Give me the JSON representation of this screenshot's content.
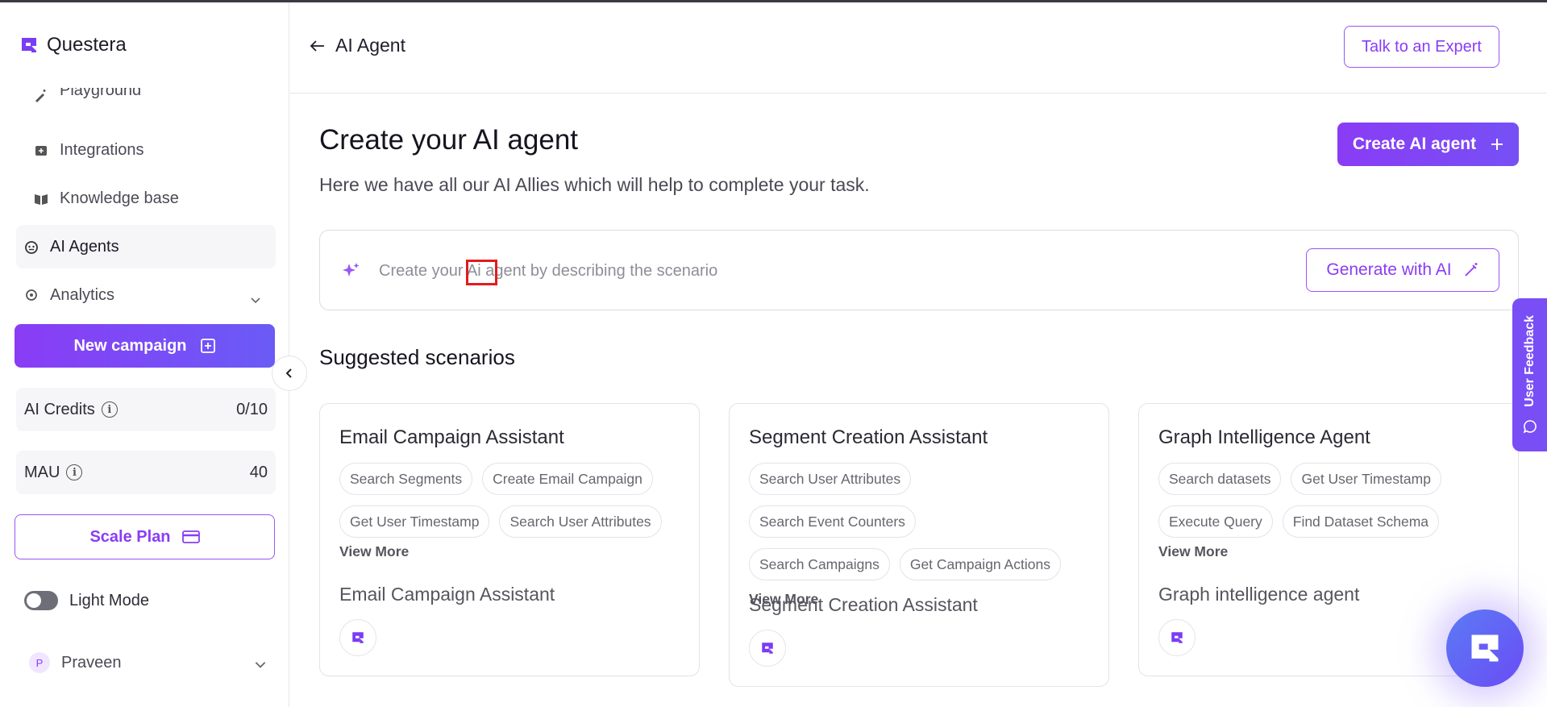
{
  "app": {
    "name": "Questera"
  },
  "sidebar": {
    "items": [
      {
        "label": "Playground",
        "icon": "wand-icon"
      },
      {
        "label": "Integrations",
        "icon": "integration-icon"
      },
      {
        "label": "Knowledge base",
        "icon": "book-icon"
      },
      {
        "label": "AI Agents",
        "icon": "robot-icon"
      },
      {
        "label": "Analytics",
        "icon": "analytics-icon"
      }
    ],
    "new_campaign_label": "New campaign",
    "ai_credits": {
      "label": "AI Credits",
      "value": "0/10"
    },
    "mau": {
      "label": "MAU",
      "value": "40"
    },
    "scale_plan_label": "Scale Plan",
    "mode_label": "Light Mode",
    "user": {
      "initial": "P",
      "name": "Praveen"
    }
  },
  "header": {
    "back_title": "AI Agent",
    "expert_label": "Talk to an Expert"
  },
  "main": {
    "title": "Create your AI agent",
    "subtitle": "Here we have all our AI Allies which will help to complete your task.",
    "create_label": "Create AI agent",
    "prompt_placeholder": "Create your Ai agent by describing the scenario",
    "generate_label": "Generate with AI",
    "section_title": "Suggested scenarios",
    "cards": [
      {
        "title": "Email Campaign Assistant",
        "tags": [
          "Search Segments",
          "Create Email Campaign",
          "Get User Timestamp",
          "Search User Attributes"
        ],
        "view_more": "View More",
        "description": "Email Campaign Assistant"
      },
      {
        "title": "Segment Creation Assistant",
        "tags": [
          "Search User Attributes",
          "Search Event Counters",
          "Search Campaigns",
          "Get Campaign Actions"
        ],
        "view_more": "View More",
        "description": "Segment Creation Assistant"
      },
      {
        "title": "Graph Intelligence Agent",
        "tags": [
          "Search datasets",
          "Get User Timestamp",
          "Execute Query",
          "Find Dataset Schema"
        ],
        "view_more": "View More",
        "description": "Graph intelligence agent"
      }
    ]
  },
  "feedback_label": "User Feedback",
  "colors": {
    "accent": "#8a3cf5",
    "highlight": "#e11d1d"
  }
}
